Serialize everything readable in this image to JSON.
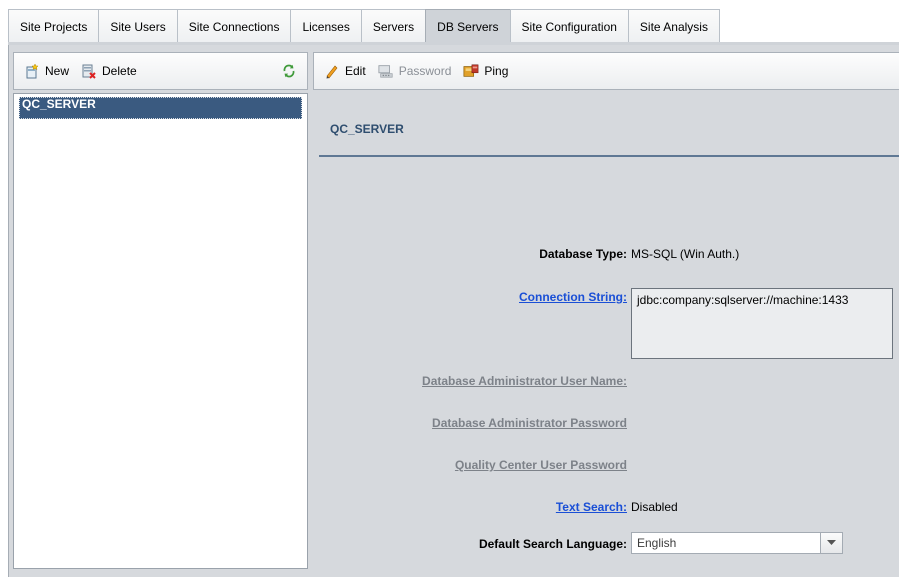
{
  "tabs": [
    {
      "label": "Site Projects",
      "active": false
    },
    {
      "label": "Site Users",
      "active": false
    },
    {
      "label": "Site Connections",
      "active": false
    },
    {
      "label": "Licenses",
      "active": false
    },
    {
      "label": "Servers",
      "active": false
    },
    {
      "label": "DB Servers",
      "active": true
    },
    {
      "label": "Site Configuration",
      "active": false
    },
    {
      "label": "Site Analysis",
      "active": false
    }
  ],
  "left_toolbar": {
    "new_label": "New",
    "delete_label": "Delete",
    "new_icon": "new-item-icon",
    "delete_icon": "delete-icon",
    "refresh_icon": "refresh-icon"
  },
  "tree": {
    "items": [
      {
        "label": "QC_SERVER",
        "selected": true
      }
    ]
  },
  "right_toolbar": {
    "edit_label": "Edit",
    "password_label": "Password",
    "ping_label": "Ping",
    "edit_icon": "pencil-icon",
    "password_icon": "password-icon",
    "ping_icon": "ping-icon"
  },
  "details": {
    "title": "QC_SERVER",
    "db_type_label": "Database Type:",
    "db_type_value": "MS-SQL (Win Auth.)",
    "conn_string_label": "Connection String:",
    "conn_string_value": "jdbc:company:sqlserver://machine:1433",
    "db_admin_user_label": "Database Administrator User Name:",
    "db_admin_password_label": "Database Administrator Password",
    "qc_user_password_label": "Quality Center User Password",
    "text_search_label": "Text Search:",
    "text_search_value": "Disabled",
    "default_lang_label": "Default Search Language:",
    "default_lang_value": "English"
  },
  "colors": {
    "selection": "#3a5a80",
    "link": "#1a4fd6",
    "panel": "#d6d9dd",
    "title": "#2f4e6f"
  }
}
